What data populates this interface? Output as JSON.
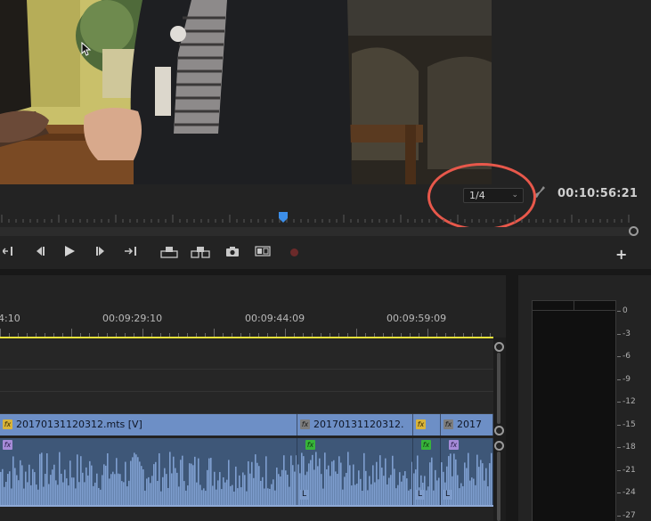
{
  "monitor": {
    "resolution_select": "1/4",
    "timecode": "00:10:56:21",
    "transport_buttons": [
      {
        "name": "mark-out-icon",
        "glyph": "→{"
      },
      {
        "name": "step-back-icon",
        "glyph": "◀|"
      },
      {
        "name": "play-icon",
        "glyph": "▶"
      },
      {
        "name": "step-forward-icon",
        "glyph": "|▶"
      },
      {
        "name": "go-to-out-icon",
        "glyph": "→|"
      },
      {
        "name": "lift-icon",
        "glyph": "⬒"
      },
      {
        "name": "extract-icon",
        "glyph": "⬓"
      },
      {
        "name": "export-frame-icon",
        "glyph": "📷"
      },
      {
        "name": "comparison-view-icon",
        "glyph": "▣"
      },
      {
        "name": "record-icon",
        "glyph": "●"
      }
    ],
    "add_button": "+"
  },
  "timeline": {
    "ruler_labels": [
      "4:10",
      "00:09:29:10",
      "00:09:44:09",
      "00:09:59:09"
    ],
    "video_clips": [
      {
        "label": "20170131120312.mts [V]",
        "fx": "yellow"
      },
      {
        "label": "20170131120312.",
        "fx": "gray"
      },
      {
        "label": "",
        "fx": "yellow"
      },
      {
        "label": "2017",
        "fx": "gray"
      }
    ],
    "audio_clips": [
      {
        "fx": "purple",
        "l": ""
      },
      {
        "fx": "green",
        "l": "L"
      },
      {
        "fx": "green",
        "l": "L"
      },
      {
        "fx": "purple",
        "l": "L"
      }
    ]
  },
  "meter": {
    "db_labels": [
      "0",
      "-3",
      "-6",
      "-9",
      "-12",
      "-15",
      "-18",
      "-21",
      "-24",
      "-27"
    ]
  },
  "colors": {
    "highlight_ring": "#e8584b",
    "video_clip": "#6d8fc6",
    "audio_clip": "#3e5778",
    "work_area": "#e8e23a"
  }
}
